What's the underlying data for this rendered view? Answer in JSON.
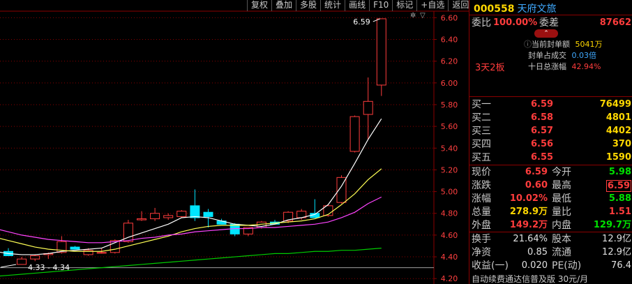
{
  "toolbar": [
    "复权",
    "叠加",
    "多股",
    "统计",
    "画线",
    "F10",
    "标记",
    "+自选",
    "返回"
  ],
  "chart": {
    "y_ticks": [
      "6.60",
      "6.40",
      "6.20",
      "6.00",
      "5.80",
      "5.60",
      "5.40",
      "5.20",
      "5.00",
      "4.80",
      "4.60",
      "4.40",
      "4.20"
    ],
    "high_label": "6.59",
    "low_label": "4.33 - 4.34",
    "colors": {
      "up": "#ff3c3c",
      "down": "#00e5ff",
      "ma5": "#ffffff",
      "ma10": "#ffff55",
      "ma20": "#ff44ff",
      "ma60": "#00cc00",
      "grid": "#8b0000",
      "axis_text": "#ff4040"
    }
  },
  "chart_data": {
    "type": "candlestick",
    "ylim": [
      4.15,
      6.66
    ],
    "candles": [
      {
        "o": 4.45,
        "h": 4.48,
        "l": 4.41,
        "c": 4.41
      },
      {
        "o": 4.33,
        "h": 4.4,
        "l": 4.33,
        "c": 4.38
      },
      {
        "o": 4.38,
        "h": 4.42,
        "l": 4.36,
        "c": 4.41
      },
      {
        "o": 4.42,
        "h": 4.44,
        "l": 4.38,
        "c": 4.43
      },
      {
        "o": 4.44,
        "h": 4.59,
        "l": 4.43,
        "c": 4.54
      },
      {
        "o": 4.49,
        "h": 4.5,
        "l": 4.47,
        "c": 4.47
      },
      {
        "o": 4.42,
        "h": 4.48,
        "l": 4.41,
        "c": 4.46
      },
      {
        "o": 4.44,
        "h": 4.48,
        "l": 4.43,
        "c": 4.44
      },
      {
        "o": 4.44,
        "h": 4.56,
        "l": 4.43,
        "c": 4.55
      },
      {
        "o": 4.54,
        "h": 4.74,
        "l": 4.53,
        "c": 4.71
      },
      {
        "o": 4.74,
        "h": 4.82,
        "l": 4.73,
        "c": 4.75
      },
      {
        "o": 4.75,
        "h": 4.85,
        "l": 4.73,
        "c": 4.8
      },
      {
        "o": 4.76,
        "h": 4.8,
        "l": 4.74,
        "c": 4.78
      },
      {
        "o": 4.77,
        "h": 4.83,
        "l": 4.76,
        "c": 4.82
      },
      {
        "o": 4.87,
        "h": 5.02,
        "l": 4.73,
        "c": 4.76
      },
      {
        "o": 4.81,
        "h": 4.84,
        "l": 4.67,
        "c": 4.77
      },
      {
        "o": 4.73,
        "h": 4.75,
        "l": 4.71,
        "c": 4.7
      },
      {
        "o": 4.7,
        "h": 4.71,
        "l": 4.59,
        "c": 4.61
      },
      {
        "o": 4.61,
        "h": 4.64,
        "l": 4.59,
        "c": 4.67
      },
      {
        "o": 4.67,
        "h": 4.73,
        "l": 4.66,
        "c": 4.72
      },
      {
        "o": 4.72,
        "h": 4.74,
        "l": 4.7,
        "c": 4.7
      },
      {
        "o": 4.73,
        "h": 4.82,
        "l": 4.71,
        "c": 4.81
      },
      {
        "o": 4.76,
        "h": 4.84,
        "l": 4.74,
        "c": 4.82
      },
      {
        "o": 4.8,
        "h": 4.93,
        "l": 4.76,
        "c": 4.76
      },
      {
        "o": 4.78,
        "h": 4.88,
        "l": 4.77,
        "c": 4.87
      },
      {
        "o": 4.9,
        "h": 5.15,
        "l": 4.89,
        "c": 5.13
      },
      {
        "o": 5.37,
        "h": 5.7,
        "l": 5.36,
        "c": 5.69
      },
      {
        "o": 5.71,
        "h": 6.05,
        "l": 5.48,
        "c": 5.83
      },
      {
        "o": 5.98,
        "h": 6.59,
        "l": 5.88,
        "c": 6.59
      }
    ],
    "ma5": [
      4.45,
      4.43,
      4.42,
      4.42,
      4.43,
      4.45,
      4.46,
      4.47,
      4.48,
      4.53,
      4.58,
      4.62,
      4.66,
      4.7,
      4.76,
      4.77,
      4.76,
      4.73,
      4.7,
      4.69,
      4.68,
      4.7,
      4.74,
      4.76,
      4.79,
      4.88,
      5.05,
      5.26,
      5.48,
      5.67
    ],
    "ma10": [
      4.58,
      4.55,
      4.52,
      4.49,
      4.47,
      4.46,
      4.45,
      4.45,
      4.45,
      4.47,
      4.5,
      4.53,
      4.56,
      4.59,
      4.63,
      4.66,
      4.68,
      4.69,
      4.69,
      4.69,
      4.7,
      4.71,
      4.72,
      4.73,
      4.75,
      4.79,
      4.88,
      4.98,
      5.11,
      5.21
    ],
    "ma20": [
      4.66,
      4.63,
      4.6,
      4.58,
      4.56,
      4.55,
      4.54,
      4.53,
      4.53,
      4.54,
      4.55,
      4.57,
      4.58,
      4.6,
      4.61,
      4.63,
      4.64,
      4.65,
      4.66,
      4.66,
      4.67,
      4.67,
      4.68,
      4.69,
      4.7,
      4.72,
      4.76,
      4.81,
      4.89,
      4.95
    ],
    "ma60": [
      4.22,
      4.23,
      4.24,
      4.25,
      4.26,
      4.27,
      4.28,
      4.29,
      4.3,
      4.31,
      4.32,
      4.33,
      4.34,
      4.35,
      4.36,
      4.37,
      4.38,
      4.39,
      4.4,
      4.41,
      4.42,
      4.43,
      4.43,
      4.44,
      4.45,
      4.45,
      4.46,
      4.46,
      4.47,
      4.48
    ]
  },
  "quote": {
    "code": "000558",
    "name": "天府文旅",
    "weibi_label": "委比",
    "weibi_value": "100.00%",
    "weicha_label": "委差",
    "weicha_value": "87662",
    "seal_amount_label": "当前封单额",
    "seal_amount_value": "5041万",
    "seal_ratio_label": "封单占成交",
    "seal_ratio_value": "0.03倍",
    "ten_day_label": "十日总涨幅",
    "ten_day_value": "42.94%",
    "streak": "3天2板",
    "bids": [
      {
        "label": "买一",
        "price": "6.59",
        "vol": "76499"
      },
      {
        "label": "买二",
        "price": "6.58",
        "vol": "4801"
      },
      {
        "label": "买三",
        "price": "6.57",
        "vol": "4402"
      },
      {
        "label": "买四",
        "price": "6.56",
        "vol": "370"
      },
      {
        "label": "买五",
        "price": "6.55",
        "vol": "1590"
      }
    ],
    "stats": [
      {
        "l1": "现价",
        "v1": "6.59",
        "c1": "red",
        "l2": "今开",
        "v2": "5.98",
        "c2": "grn"
      },
      {
        "l1": "涨跌",
        "v1": "0.60",
        "c1": "red",
        "l2": "最高",
        "v2": "6.59",
        "c2": "red"
      },
      {
        "l1": "涨幅",
        "v1": "10.02%",
        "c1": "red",
        "l2": "最低",
        "v2": "5.88",
        "c2": "grn"
      },
      {
        "l1": "总量",
        "v1": "278.9万",
        "c1": "yel",
        "l2": "量比",
        "v2": "1.51",
        "c2": "red"
      },
      {
        "l1": "外盘",
        "v1": "149.2万",
        "c1": "red",
        "l2": "内盘",
        "v2": "129.7万",
        "c2": "grn"
      }
    ],
    "fund": [
      {
        "l1": "换手",
        "v1": "21.64%",
        "l2": "股本",
        "v2": "12.9亿"
      },
      {
        "l1": "净资",
        "v1": "0.85",
        "l2": "流通",
        "v2": "12.9亿"
      },
      {
        "l1": "收益(一)",
        "v1": "0.020",
        "l2": "PE(动)",
        "v2": "76.4"
      }
    ],
    "status": "自动续费通达信普及版 30元/月"
  }
}
